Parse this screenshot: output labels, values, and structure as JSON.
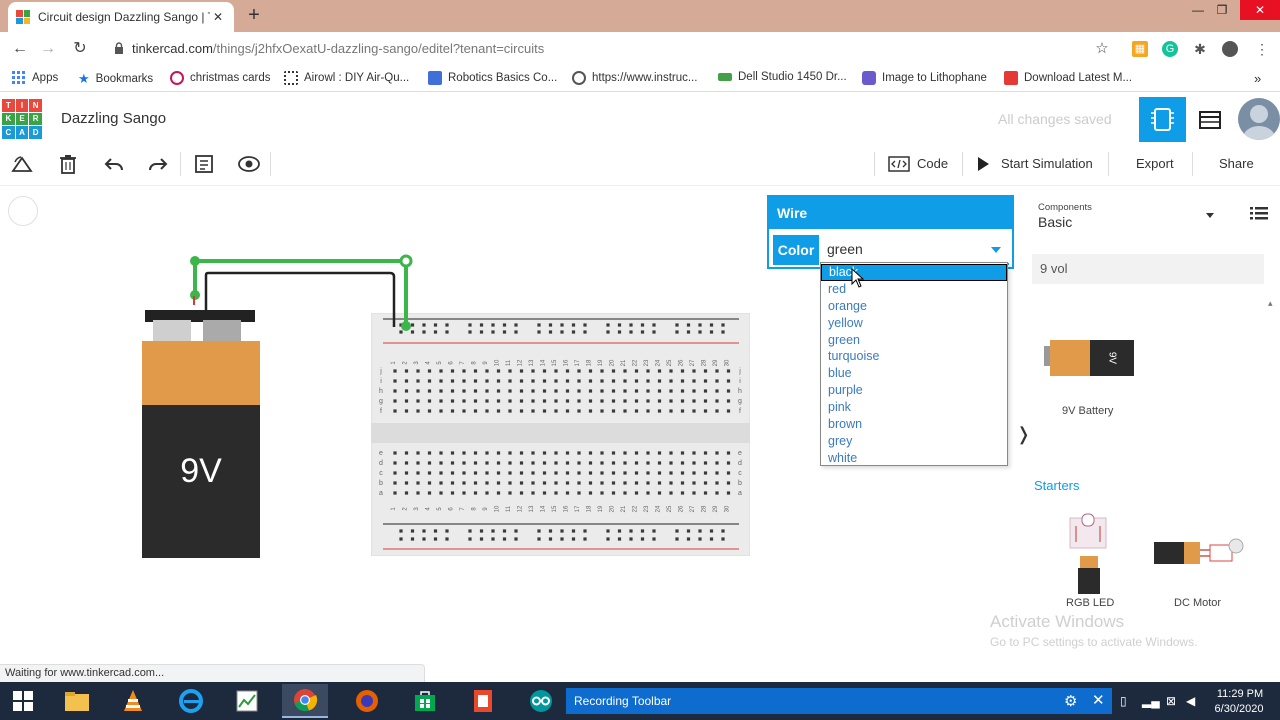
{
  "browser": {
    "tab_title": "Circuit design Dazzling Sango | T",
    "url_main": "tinkercad.com",
    "url_path": "/things/j2hfxOexatU-dazzling-sango/editel?tenant=circuits",
    "bookmarks": [
      {
        "label": "Apps",
        "color": "#4285f4"
      },
      {
        "label": "Bookmarks",
        "color": "#1a73e8"
      },
      {
        "label": "christmas cards",
        "color": "#c2185b"
      },
      {
        "label": "Airowl : DIY Air-Qu...",
        "color": "#333333"
      },
      {
        "label": "Robotics Basics Co...",
        "color": "#3f6fd8"
      },
      {
        "label": "https://www.instruc...",
        "color": "#555555"
      },
      {
        "label": "Dell Studio 1450 Dr...",
        "color": "#43a047"
      },
      {
        "label": "Image to Lithophane",
        "color": "#6a5acd"
      },
      {
        "label": "Download Latest M...",
        "color": "#e53935"
      }
    ],
    "status": "Waiting for www.tinkercad.com..."
  },
  "app": {
    "logo_letters": [
      "TIN",
      "KER",
      "CAD"
    ],
    "design_title": "Dazzling Sango",
    "save_status": "All changes saved",
    "toolbar": {
      "code_label": "Code",
      "simulate_label": "Start Simulation",
      "export_label": "Export",
      "share_label": "Share"
    }
  },
  "inspector": {
    "title": "Wire",
    "color_label": "Color",
    "color_value": "green",
    "options": [
      "black",
      "red",
      "orange",
      "yellow",
      "green",
      "turquoise",
      "blue",
      "purple",
      "pink",
      "brown",
      "grey",
      "white"
    ],
    "highlighted": "black"
  },
  "components": {
    "header_label": "Components",
    "category": "Basic",
    "search_value": "9 vol",
    "battery_label": "9V Battery",
    "battery_text": "9V",
    "starters_title": "Starters",
    "starters": [
      "RGB LED",
      "DC Motor"
    ]
  },
  "canvas": {
    "battery_label": "9V",
    "breadboard_cols": [
      "1",
      "2",
      "3",
      "4",
      "5",
      "6",
      "7",
      "8",
      "9",
      "10",
      "11",
      "12",
      "13",
      "14",
      "15",
      "16",
      "17",
      "18",
      "19",
      "20",
      "21",
      "22",
      "23",
      "24",
      "25",
      "26",
      "27",
      "28",
      "29",
      "30"
    ],
    "row_letters_top": [
      "j",
      "i",
      "h",
      "g",
      "f"
    ],
    "row_letters_bottom": [
      "e",
      "d",
      "c",
      "b",
      "a"
    ]
  },
  "watermark": {
    "line1": "Activate Windows",
    "line2": "Go to PC settings to activate Windows."
  },
  "taskbar": {
    "recording_label": "Recording Toolbar",
    "time": "11:29 PM",
    "date": "6/30/2020"
  },
  "colors": {
    "accent": "#0f9de8",
    "wire_green": "#3cb54a",
    "battery_orange": "#e09a4a",
    "battery_black": "#2b2b2b"
  }
}
